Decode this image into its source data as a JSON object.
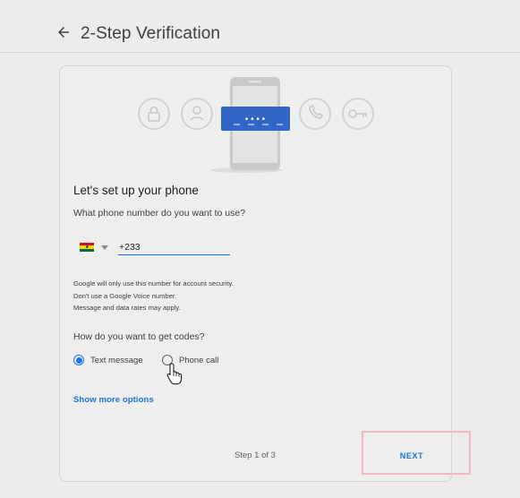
{
  "header": {
    "title": "2-Step Verification",
    "back_icon": "arrow-left-icon"
  },
  "illustration": {
    "icons": [
      "lock-icon",
      "account-circle-icon",
      "phone-icon",
      "key-icon"
    ],
    "password_dots": "• • • •",
    "accent": "#3166c6"
  },
  "setup": {
    "heading": "Let's set up your phone",
    "question": "What phone number do you want to use?",
    "country_flag": "ghana-flag-icon",
    "phone_value": "+233",
    "disclaimer_lines": [
      "Google will only use this number for account security.",
      "Don't use a Google Voice number.",
      "Message and data rates may apply."
    ],
    "codes_question": "How do you want to get codes?",
    "options": [
      {
        "label": "Text message",
        "selected": true
      },
      {
        "label": "Phone call",
        "selected": false
      }
    ],
    "more_options": "Show more options"
  },
  "footer": {
    "step": "Step 1 of 3",
    "next_label": "NEXT"
  },
  "colors": {
    "link": "#1a73e8",
    "highlight": "#f2b6c6",
    "background": "#ececea"
  }
}
